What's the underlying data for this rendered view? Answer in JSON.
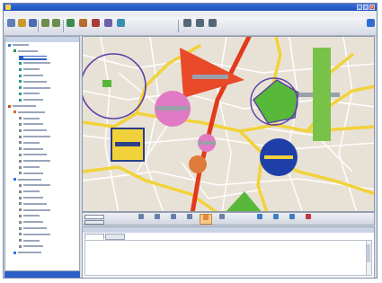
{
  "window": {
    "title": "",
    "buttons": {
      "min": "_",
      "max": "□",
      "close": "x"
    }
  },
  "menubar": {
    "items": [
      "",
      "",
      "",
      "",
      "",
      ""
    ]
  },
  "toolbar": {
    "groups": [
      {
        "icon": "new-icon",
        "color": "#5f7fb8"
      },
      {
        "icon": "open-icon",
        "color": "#c99a2e"
      },
      {
        "icon": "save-icon",
        "color": "#4a6db0"
      },
      {
        "icon": "undo-icon",
        "color": "#6b8e4e"
      },
      {
        "icon": "redo-icon",
        "color": "#6b8e4e"
      },
      {
        "icon": "map-icon",
        "color": "#3f8a52"
      },
      {
        "icon": "layer-icon",
        "color": "#b86b2e"
      },
      {
        "icon": "route-icon",
        "color": "#a63c3c"
      },
      {
        "icon": "filter-icon",
        "color": "#6f5fa8"
      },
      {
        "icon": "chart-icon",
        "color": "#3a8fb0"
      },
      {
        "icon": "user-icon",
        "color": "#556677"
      },
      {
        "icon": "print-icon",
        "color": "#556677"
      },
      {
        "icon": "settings-icon",
        "color": "#556677"
      },
      {
        "icon": "help-icon",
        "color": "#2f6fd0"
      }
    ]
  },
  "left_panel": {
    "header": "",
    "footer": "",
    "tree": [
      {
        "level": 0,
        "label": "",
        "color": "#3a6fd8"
      },
      {
        "level": 1,
        "label": "",
        "color": "#3a8f4a"
      },
      {
        "level": 2,
        "label": "",
        "color": "#2b5fc7",
        "selected": true
      },
      {
        "level": 2,
        "label": "",
        "color": "#2f9a8a"
      },
      {
        "level": 2,
        "label": "",
        "color": "#2f9a8a"
      },
      {
        "level": 2,
        "label": "",
        "color": "#2f9a8a"
      },
      {
        "level": 2,
        "label": "",
        "color": "#2f9a8a"
      },
      {
        "level": 2,
        "label": "",
        "color": "#2f9a8a"
      },
      {
        "level": 2,
        "label": "",
        "color": "#2f9a8a"
      },
      {
        "level": 2,
        "label": "",
        "color": "#2f9a8a"
      },
      {
        "level": 0,
        "label": "",
        "color": "#c24f2e"
      },
      {
        "level": 1,
        "label": "",
        "color": "#d06b2e"
      },
      {
        "level": 2,
        "label": "",
        "color": "#888888"
      },
      {
        "level": 2,
        "label": "",
        "color": "#888888"
      },
      {
        "level": 2,
        "label": "",
        "color": "#888888"
      },
      {
        "level": 2,
        "label": "",
        "color": "#888888"
      },
      {
        "level": 2,
        "label": "",
        "color": "#888888"
      },
      {
        "level": 2,
        "label": "",
        "color": "#888888"
      },
      {
        "level": 2,
        "label": "",
        "color": "#888888"
      },
      {
        "level": 2,
        "label": "",
        "color": "#888888"
      },
      {
        "level": 2,
        "label": "",
        "color": "#888888"
      },
      {
        "level": 2,
        "label": "",
        "color": "#888888"
      },
      {
        "level": 1,
        "label": "",
        "color": "#3a6fd8"
      },
      {
        "level": 2,
        "label": "",
        "color": "#888888"
      },
      {
        "level": 2,
        "label": "",
        "color": "#888888"
      },
      {
        "level": 2,
        "label": "",
        "color": "#888888"
      },
      {
        "level": 2,
        "label": "",
        "color": "#888888"
      },
      {
        "level": 2,
        "label": "",
        "color": "#888888"
      },
      {
        "level": 2,
        "label": "",
        "color": "#888888"
      },
      {
        "level": 2,
        "label": "",
        "color": "#888888"
      },
      {
        "level": 2,
        "label": "",
        "color": "#888888"
      },
      {
        "level": 2,
        "label": "",
        "color": "#888888"
      },
      {
        "level": 2,
        "label": "",
        "color": "#888888"
      },
      {
        "level": 2,
        "label": "",
        "color": "#888888"
      },
      {
        "level": 1,
        "label": "",
        "color": "#3a6fd8"
      }
    ]
  },
  "map": {
    "colors": {
      "background": "#e8e2d6",
      "major_road": "#e23a1c",
      "road": "#f2d23a",
      "minor_street": "#ffffff"
    },
    "markers": [
      {
        "name": "purple-circle-outline",
        "color": "#5b3fa8"
      },
      {
        "name": "pink-circle",
        "color": "#e07ac4"
      },
      {
        "name": "yellow-square-marker",
        "color": "#f2d23a"
      },
      {
        "name": "pink-small-circle",
        "color": "#e07ac4"
      },
      {
        "name": "orange-circle",
        "color": "#e07a3a"
      },
      {
        "name": "green-pentagon",
        "color": "#57b83a"
      },
      {
        "name": "blue-circle",
        "color": "#1f3fa8"
      },
      {
        "name": "green-rectangle",
        "color": "#79c24a"
      },
      {
        "name": "red-triangle",
        "color": "#e84a2a"
      },
      {
        "name": "green-triangle-bottom",
        "color": "#57b83a"
      }
    ]
  },
  "map_toolbar": {
    "zoom_value": "",
    "properties_label": "",
    "buttons": [
      {
        "icon": "pan-icon",
        "color": "#6b7fa8"
      },
      {
        "icon": "zoom-in-icon",
        "color": "#6b7fa8"
      },
      {
        "icon": "zoom-out-icon",
        "color": "#6b7fa8"
      },
      {
        "icon": "extent-icon",
        "color": "#6b7fa8"
      },
      {
        "icon": "highlight-icon",
        "color": "#e0893a",
        "active": true
      },
      {
        "icon": "select-icon",
        "color": "#6b7fa8"
      },
      {
        "icon": "measure-icon",
        "color": "#3a7fc2"
      },
      {
        "icon": "route-tool-icon",
        "color": "#3a7fc2"
      },
      {
        "icon": "locate-icon",
        "color": "#3a7fc2"
      },
      {
        "icon": "export-icon",
        "color": "#c23a3a"
      }
    ]
  },
  "bottom_panel": {
    "header": "",
    "tabs": [
      {
        "label": "",
        "active": true
      },
      {
        "label": "",
        "active": false
      }
    ]
  }
}
